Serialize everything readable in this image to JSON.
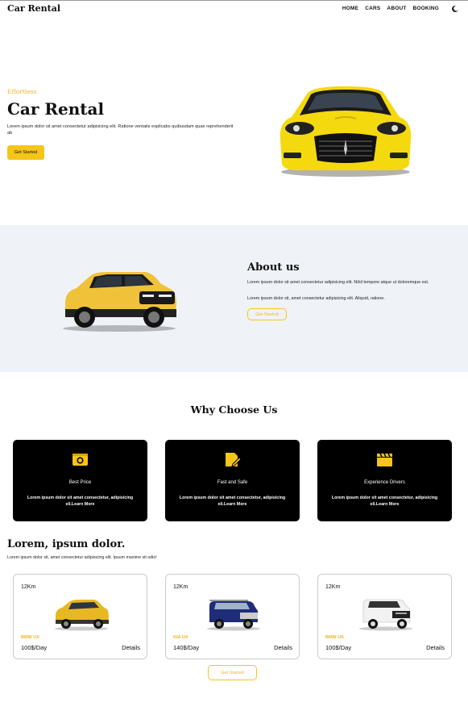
{
  "nav": {
    "brand": "Car Rental",
    "items": [
      "HOME",
      "CARS",
      "ABOUT",
      "BOOKING"
    ],
    "theme_icon": "moon-icon"
  },
  "hero": {
    "eyebrow": "Effortless",
    "title": "Car Rental",
    "text": "Lorem ipsum dolor sit amet consectetur adipisicing elit. Ratione ventatis explicabo quibusdam quae reprehenderit ab",
    "button": "Get Started"
  },
  "about": {
    "title": "About us",
    "p1": "Lorem ipsum dolor sit amet consectetur adipisicing elit. Nihil tempore atque ut doloremque est.",
    "p2": "Lorem ipsum dolor sit, amet consectetur adipisicing elit. Aliquid, ratione.",
    "button": "Get Started"
  },
  "why": {
    "title": "Why Choose Us",
    "features": [
      {
        "icon": "wallet-icon",
        "title": "Best Price",
        "text": "Lorem ipsum dolor sit amet consectetur, adipisicing eli.Learn More"
      },
      {
        "icon": "edit-document-icon",
        "title": "Fast and Safe",
        "text": "Lorem ipsum dolor sit amet consectetur, adipisicing eli.Learn More"
      },
      {
        "icon": "clapperboard-icon",
        "title": "Experience Drivers",
        "text": "Lorem ipsum dolor sit amet consectetur, adipisicing eli.Learn More"
      }
    ]
  },
  "cars": {
    "title": "Lorem, ipsum dolor.",
    "subtitle": "Lorem ipsum dolor sit, amet consectetur adipisicing elit. Ipsum maxime sit odio!",
    "items": [
      {
        "km": "12Km",
        "name": "BMW UX",
        "price": "100$/Day",
        "details": "Details",
        "color": "#e8b823"
      },
      {
        "km": "12Km",
        "name": "KIA UX",
        "price": "140$/Day",
        "details": "Details",
        "color": "#1f2c7a"
      },
      {
        "km": "12Km",
        "name": "BMW UX",
        "price": "100$/Day",
        "details": "Details",
        "color": "#f2f2f2"
      }
    ],
    "button": "Get Started"
  },
  "colors": {
    "accent": "#f5c518",
    "about_bg": "#eff3f7",
    "card_dark": "#000000"
  }
}
